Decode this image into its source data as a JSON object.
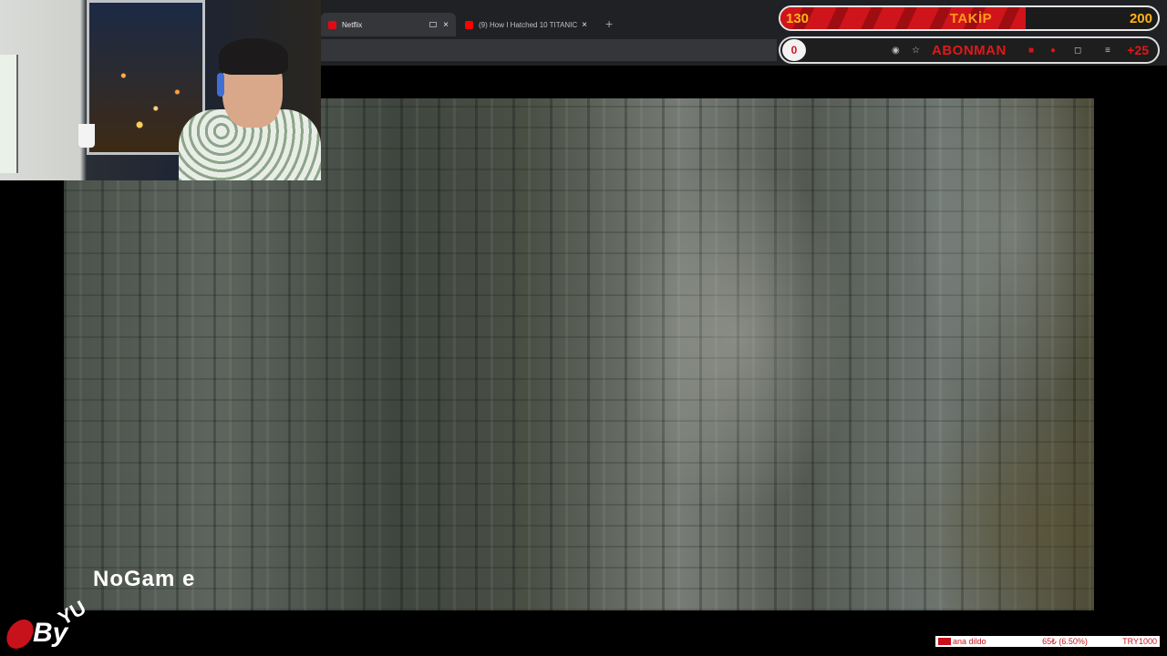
{
  "browser": {
    "tabs": [
      {
        "title": "Netflix",
        "favicon_color": "#e50914",
        "active": true
      },
      {
        "title": "(9) How I Hatched 10 TITANIC",
        "favicon_color": "#ff0000",
        "active": false
      }
    ],
    "close_glyph": "×",
    "new_tab_glyph": "+"
  },
  "video": {
    "scene": "rock-cliff-face"
  },
  "overlay": {
    "follow_goal": {
      "current": "130",
      "label": "TAKİP",
      "target": "200",
      "progress_fraction": 0.65
    },
    "sub_goal": {
      "current": "0",
      "label": "ABONMAN",
      "plus": "+25"
    }
  },
  "watermark": {
    "by": "By",
    "yu": "YU",
    "rest": "NoGam e"
  },
  "ticker": {
    "name": "ana dildo",
    "amount": "65₺ (6.50%)",
    "goal": "TRY1000"
  },
  "colors": {
    "accent_red": "#d0141b",
    "accent_orange": "#ffb31a"
  }
}
